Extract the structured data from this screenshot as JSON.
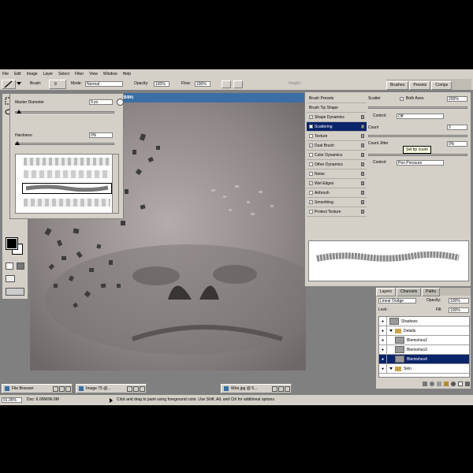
{
  "menu": {
    "items": [
      "File",
      "Edit",
      "Image",
      "Layer",
      "Select",
      "Filter",
      "View",
      "Window",
      "Help"
    ]
  },
  "options_bar": {
    "brush_label": "Brush:",
    "brush_size": "9",
    "mode_label": "Mode:",
    "mode_value": "Normal",
    "opacity_label": "Opacity:",
    "opacity_value": "100%",
    "flow_label": "Flow:",
    "flow_value": "100%",
    "height_label": "Height:"
  },
  "palette_well": {
    "tabs": [
      "Brushes",
      "Presets",
      "Comps"
    ]
  },
  "document": {
    "title_fragment": "GB/8#)"
  },
  "brush_picker": {
    "master_diameter_label": "Master Diameter",
    "master_diameter_value": "9 px",
    "hardness_label": "Hardness:",
    "hardness_value": "0%"
  },
  "brushes_panel": {
    "list": [
      {
        "label": "Brush Presets",
        "checkbox": false,
        "checked": false,
        "selected": false
      },
      {
        "label": "Brush Tip Shape",
        "checkbox": false,
        "checked": false,
        "selected": false
      },
      {
        "label": "Shape Dynamics",
        "checkbox": true,
        "checked": true,
        "selected": false
      },
      {
        "label": "Scattering",
        "checkbox": true,
        "checked": true,
        "selected": true
      },
      {
        "label": "Texture",
        "checkbox": true,
        "checked": false,
        "selected": false
      },
      {
        "label": "Dual Brush",
        "checkbox": true,
        "checked": true,
        "selected": false
      },
      {
        "label": "Color Dynamics",
        "checkbox": true,
        "checked": false,
        "selected": false
      },
      {
        "label": "Other Dynamics",
        "checkbox": true,
        "checked": false,
        "selected": false
      },
      {
        "label": "Noise",
        "checkbox": true,
        "checked": false,
        "selected": false
      },
      {
        "label": "Wet Edges",
        "checkbox": true,
        "checked": true,
        "selected": false
      },
      {
        "label": "Airbrush",
        "checkbox": true,
        "checked": false,
        "selected": false
      },
      {
        "label": "Smoothing",
        "checkbox": true,
        "checked": true,
        "selected": false
      },
      {
        "label": "Protect Texture",
        "checkbox": true,
        "checked": false,
        "selected": false
      }
    ],
    "scatter_label": "Scatter",
    "both_axes_label": "Both Axes",
    "scatter_value": "200%",
    "control_label": "Control:",
    "control_off": "Off",
    "count_label": "Count",
    "count_value": "3",
    "count_jitter_label": "Count Jitter",
    "count_jitter_value": "0%",
    "tooltip": "Set tip count",
    "control_pen": "Pen Pressure"
  },
  "layers_panel": {
    "tabs": [
      "Layers",
      "Channels",
      "Paths"
    ],
    "blend_mode": "Linear Dodge",
    "opacity_label": "Opacity:",
    "opacity_value": "100%",
    "lock_label": "Lock:",
    "fill_label": "Fill:",
    "fill_value": "100%",
    "layers": [
      {
        "name": "Shadows",
        "type": "layer",
        "selected": false
      },
      {
        "name": "Details",
        "type": "group",
        "selected": false
      },
      {
        "name": "Blemishes2",
        "type": "layer",
        "selected": false
      },
      {
        "name": "Blemishes3",
        "type": "layer",
        "selected": false
      },
      {
        "name": "Blemishes4",
        "type": "layer",
        "selected": true
      },
      {
        "name": "Skin",
        "type": "group",
        "selected": false
      }
    ]
  },
  "taskbar": {
    "items": [
      "File Browser",
      "Image 75 @...",
      "Wire.jpg @ 5..."
    ]
  },
  "status_bar": {
    "zoom": "91.05%",
    "doc": "Doc: 6.00M/96.0M",
    "hint": "Click and drag to paint using foreground color. Use Shift, Alt, and Ctrl for additional options."
  },
  "colors": {
    "panel": "#d4d0c8",
    "selection": "#0a246a",
    "title_bar": "#3a6ea5"
  }
}
